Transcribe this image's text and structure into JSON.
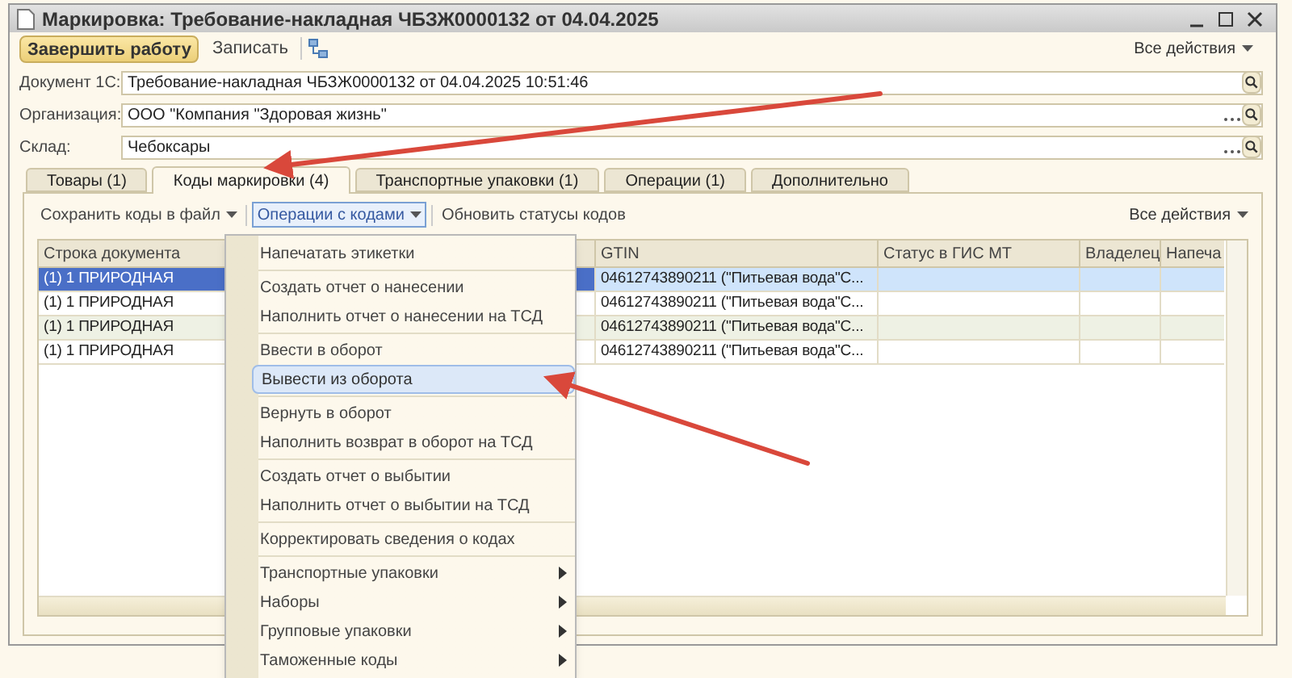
{
  "window": {
    "title": "Маркировка: Требование-накладная ЧБЗЖ0000132 от 04.04.2025"
  },
  "toolbar": {
    "primary_button": "Завершить работу",
    "save_button": "Записать",
    "all_actions": "Все действия"
  },
  "fields": [
    {
      "label": "Документ 1С:",
      "value": "Требование-накладная ЧБЗЖ0000132 от 04.04.2025 10:51:46",
      "kind": "search"
    },
    {
      "label": "Организация:",
      "value": "ООО \"Компания \"Здоровая жизнь\"",
      "kind": "select"
    },
    {
      "label": "Склад:",
      "value": "Чебоксары",
      "kind": "select"
    }
  ],
  "tabs": [
    {
      "label": "Товары (1)",
      "selected": false
    },
    {
      "label": "Коды маркировки (4)",
      "selected": true
    },
    {
      "label": "Транспортные упаковки (1)",
      "selected": false
    },
    {
      "label": "Операции (1)",
      "selected": false
    },
    {
      "label": "Дополнительно",
      "selected": false
    }
  ],
  "panel_toolbar": {
    "buttons": [
      {
        "label": "Сохранить коды в файл",
        "dropdown": true,
        "pressed": false
      },
      {
        "label": "Операции с кодами",
        "dropdown": true,
        "pressed": true
      },
      {
        "label": "Обновить статусы кодов",
        "dropdown": false,
        "pressed": false
      }
    ],
    "all_actions": "Все действия"
  },
  "table": {
    "columns": [
      "Строка документа",
      "GTIN",
      "Статус в ГИС МТ",
      "Владелец",
      "Напеча"
    ],
    "rows": [
      {
        "selected": true,
        "cells": [
          "(1) 1 ПРИРОДНАЯ",
          "04612743890211 (\"Питьевая вода\"С...",
          "",
          "",
          ""
        ]
      },
      {
        "selected": false,
        "cells": [
          "(1) 1 ПРИРОДНАЯ",
          "04612743890211 (\"Питьевая вода\"С...",
          "",
          "",
          ""
        ]
      },
      {
        "selected": false,
        "cells": [
          "(1) 1 ПРИРОДНАЯ",
          "04612743890211 (\"Питьевая вода\"С...",
          "",
          "",
          ""
        ]
      },
      {
        "selected": false,
        "cells": [
          "(1) 1 ПРИРОДНАЯ",
          "04612743890211 (\"Питьевая вода\"С...",
          "",
          "",
          ""
        ]
      }
    ]
  },
  "menu": {
    "groups": [
      [
        {
          "label": "Напечатать этикетки",
          "selected": false,
          "kind": "item"
        }
      ],
      [
        {
          "label": "Создать отчет о нанесении",
          "selected": false,
          "kind": "item"
        },
        {
          "label": "Наполнить отчет о нанесении на ТСД",
          "selected": false,
          "kind": "item"
        }
      ],
      [
        {
          "label": "Ввести в оборот",
          "selected": false,
          "kind": "item"
        },
        {
          "label": "Вывести из оборота",
          "selected": true,
          "kind": "item"
        }
      ],
      [
        {
          "label": "Вернуть в оборот",
          "selected": false,
          "kind": "item"
        },
        {
          "label": "Наполнить возврат в оборот на ТСД",
          "selected": false,
          "kind": "item"
        }
      ],
      [
        {
          "label": "Создать отчет о выбытии",
          "selected": false,
          "kind": "item"
        },
        {
          "label": "Наполнить отчет о выбытии на ТСД",
          "selected": false,
          "kind": "item"
        }
      ],
      [
        {
          "label": "Корректировать сведения о кодах",
          "selected": false,
          "kind": "item"
        }
      ],
      [
        {
          "label": "Транспортные упаковки",
          "selected": false,
          "kind": "submenu"
        },
        {
          "label": "Наборы",
          "selected": false,
          "kind": "submenu"
        },
        {
          "label": "Групповые упаковки",
          "selected": false,
          "kind": "submenu"
        },
        {
          "label": "Таможенные коды",
          "selected": false,
          "kind": "submenu"
        }
      ]
    ]
  }
}
